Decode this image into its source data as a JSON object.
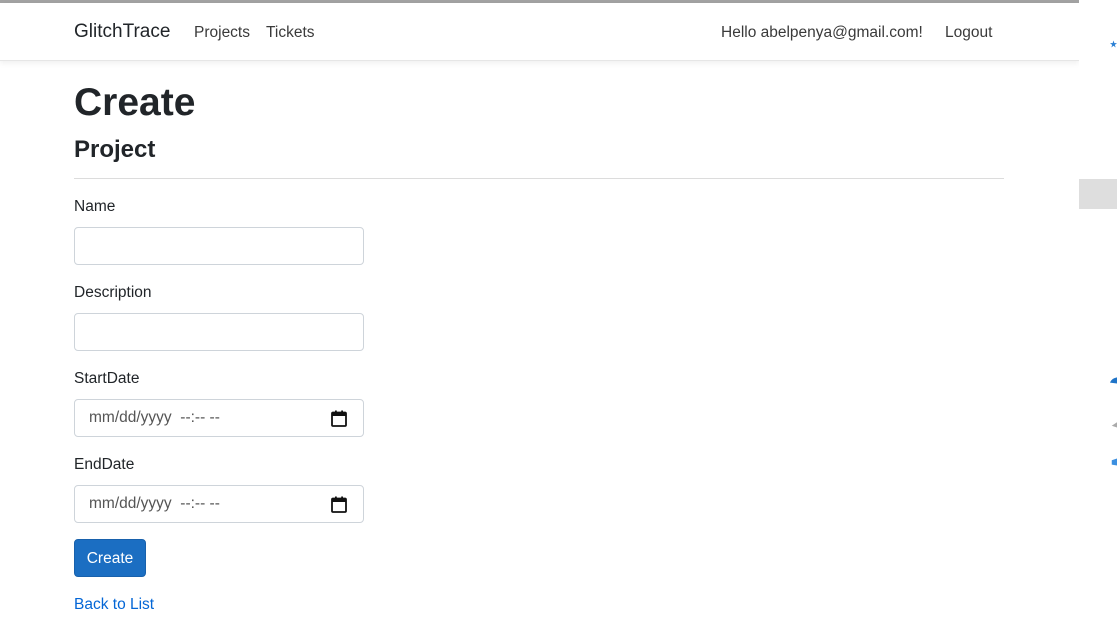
{
  "navbar": {
    "brand": "GlitchTrace",
    "links": [
      "Projects",
      "Tickets"
    ],
    "greeting": "Hello abelpenya@gmail.com!",
    "logout": "Logout"
  },
  "page": {
    "title": "Create",
    "subtitle": "Project"
  },
  "form": {
    "name_label": "Name",
    "name_value": "",
    "description_label": "Description",
    "description_value": "",
    "startdate_label": "StartDate",
    "startdate_placeholder": "mm/dd/yyyy  --:-- --",
    "enddate_label": "EndDate",
    "enddate_placeholder": "mm/dd/yyyy  --:-- --",
    "submit_label": "Create"
  },
  "footer_link": "Back to List",
  "colors": {
    "primary": "#1b6ec2",
    "link": "#0366d6"
  },
  "icons": [
    "calendar-icon"
  ]
}
